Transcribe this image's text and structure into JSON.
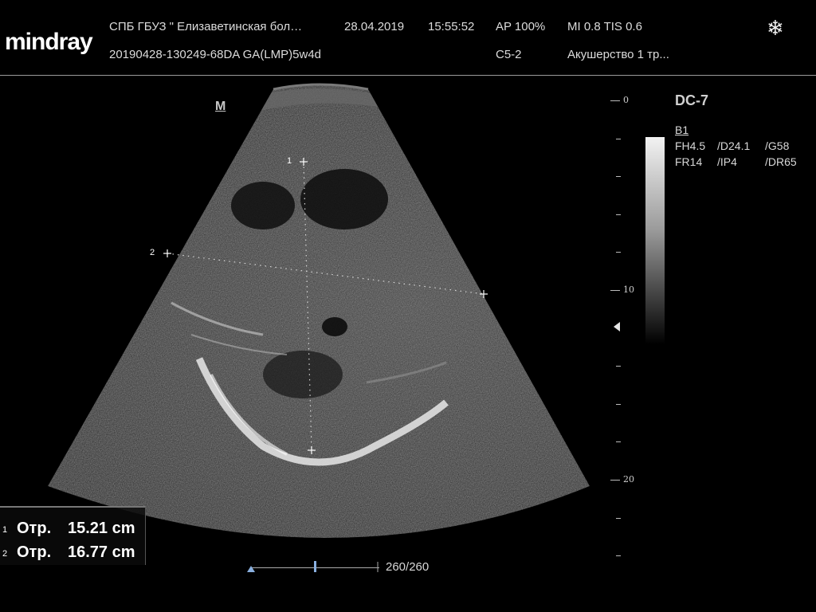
{
  "header": {
    "brand": "mindray",
    "institution": "СПБ  ГБУЗ \" Елизаветинская бол…",
    "date": "28.04.2019",
    "time": "15:55:52",
    "ap": "AP  100%",
    "mi_tis": "MI 0.8 TIS 0.6",
    "exam_id": "20190428-130249-68DA GA(LMP)5w4d",
    "probe_model": "C5-2",
    "preset": "Акушерство 1 тр..."
  },
  "mode_label": "M",
  "params": {
    "probe_setting": "DC-7",
    "mode": "B1",
    "fh": "FH4.5",
    "depth": "/D24.1",
    "gain": "/G58",
    "fr": "FR14",
    "ip": "/IP4",
    "dr": "/DR65"
  },
  "depth_scale": {
    "labels": [
      "0",
      "10",
      "20"
    ]
  },
  "calipers": {
    "marker1": "1",
    "marker2": "2"
  },
  "measurements": [
    {
      "index": "1",
      "label": "Отр.",
      "value": "15.21 cm"
    },
    {
      "index": "2",
      "label": "Отр.",
      "value": "16.77 cm"
    }
  ],
  "cine": {
    "frame_count": "260/260"
  },
  "icons": {
    "freeze": "snowflake-icon",
    "focus": "focus-triangle-icon"
  }
}
